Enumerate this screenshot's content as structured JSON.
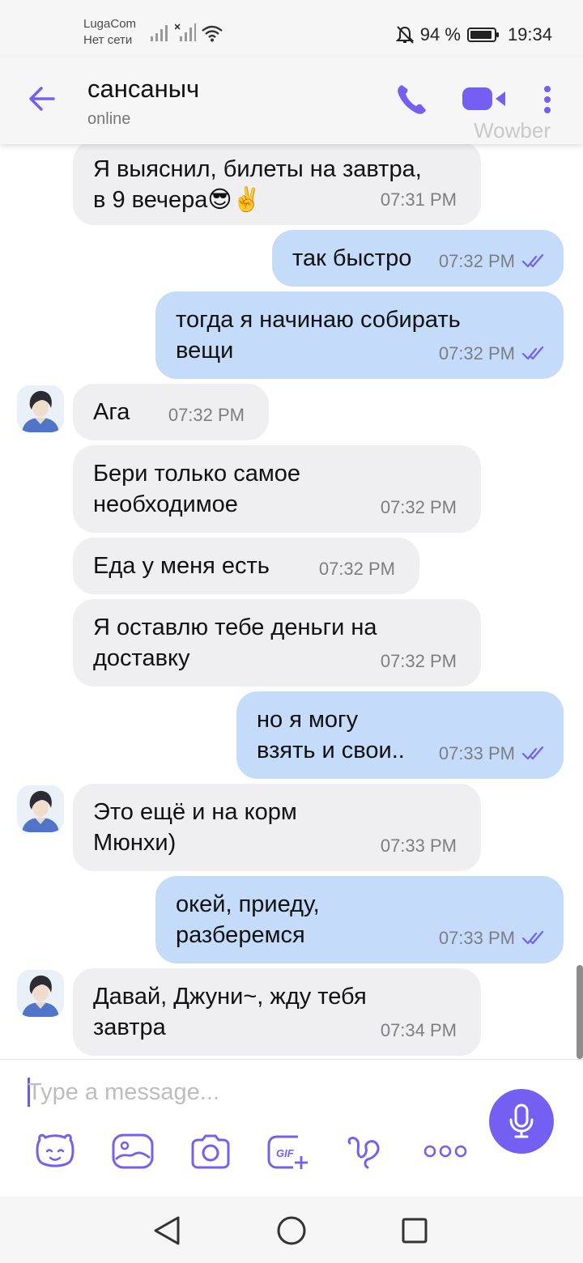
{
  "status_bar": {
    "carrier": "LugaCom",
    "network": "Нет сети",
    "battery_percent": "94 %",
    "battery_level": 0.94,
    "time": "19:34"
  },
  "header": {
    "contact_name": "сансаныч",
    "status": "online",
    "watermark": "Wowber",
    "icons": [
      "back-arrow-icon",
      "phone-icon",
      "video-camera-icon",
      "more-vertical-icon"
    ],
    "accent_color": "#7360f2"
  },
  "messages": [
    {
      "dir": "in",
      "text": "Я выяснил, билеты на завтра,\nв 9 вечера😎✌️",
      "time": "07:31 PM"
    },
    {
      "dir": "out",
      "text": "так быстро",
      "time": "07:32 PM"
    },
    {
      "dir": "out",
      "text": "тогда я начинаю собирать\nвещи",
      "time": "07:32 PM"
    },
    {
      "dir": "in",
      "text": "Ага",
      "time": "07:32 PM"
    },
    {
      "dir": "in",
      "text": "Бери только самое\nнеобходимое",
      "time": "07:32 PM"
    },
    {
      "dir": "in",
      "text": "Еда у меня есть",
      "time": "07:32 PM"
    },
    {
      "dir": "in",
      "text": "Я оставлю тебе деньги на\nдоставку",
      "time": "07:32 PM"
    },
    {
      "dir": "out",
      "text": "но я могу\nвзять и свои..",
      "time": "07:33 PM"
    },
    {
      "dir": "in",
      "text": "Это ещё и на корм\nМюнхи)",
      "time": "07:33 PM"
    },
    {
      "dir": "out",
      "text": "окей, приеду,\nразберемся",
      "time": "07:33 PM"
    },
    {
      "dir": "in",
      "text": "Давай, Джуни~, жду тебя\nзавтра",
      "time": "07:34 PM"
    }
  ],
  "composer": {
    "placeholder": "Type a message...",
    "value": "",
    "tools": [
      "sticker-icon",
      "gallery-icon",
      "camera-icon",
      "gif-icon",
      "doodle-icon",
      "more-horizontal-icon"
    ],
    "mic_icon": "microphone-icon"
  },
  "nav": {
    "icons": [
      "nav-back-icon",
      "nav-home-icon",
      "nav-recents-icon"
    ]
  }
}
